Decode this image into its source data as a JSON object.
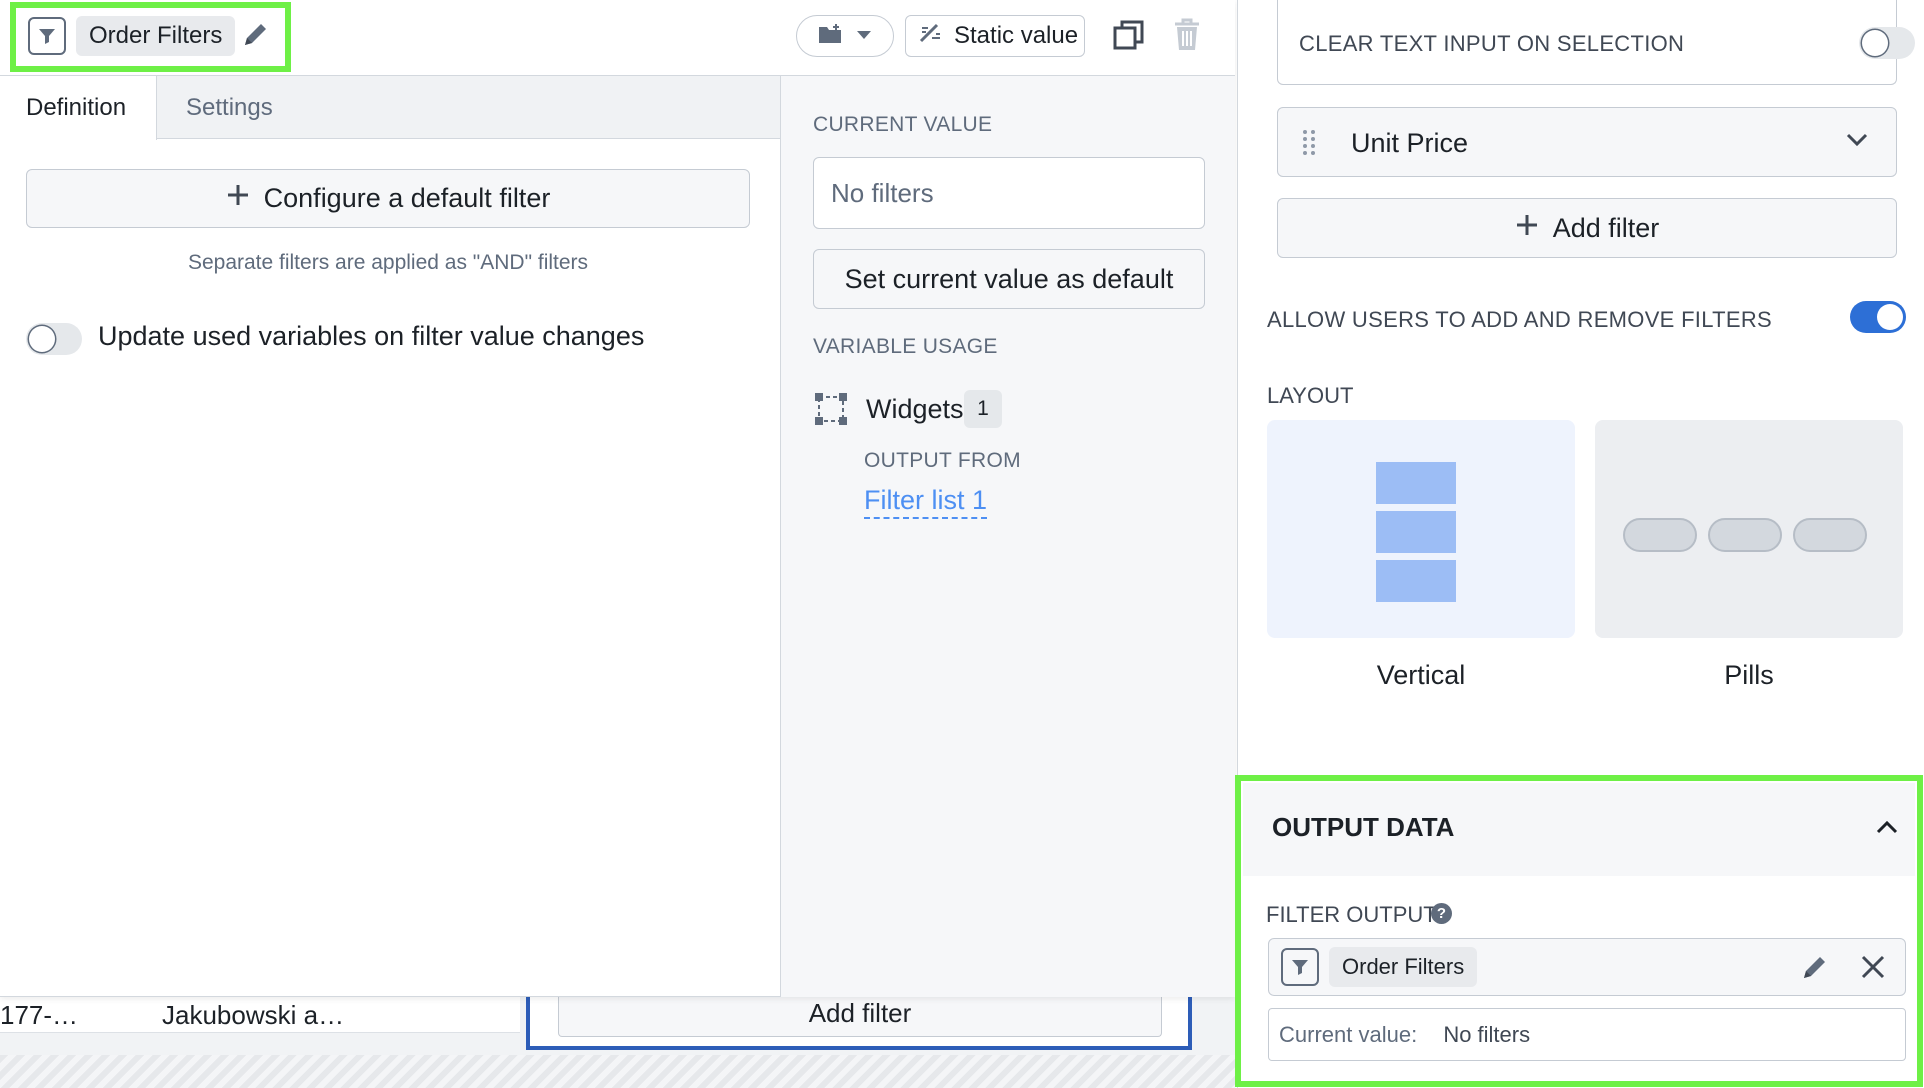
{
  "header": {
    "title": "Order Filters",
    "static_value_label": "Static value"
  },
  "tabs": [
    {
      "label": "Definition",
      "active": true
    },
    {
      "label": "Settings",
      "active": false
    }
  ],
  "definition": {
    "configure_button": "Configure a default filter",
    "and_note": "Separate filters are applied as \"AND\" filters",
    "update_toggle_label": "Update used variables on filter value changes",
    "update_toggle_on": false
  },
  "current_value": {
    "caption": "CURRENT VALUE",
    "value": "No filters",
    "set_default_button": "Set current value as default"
  },
  "variable_usage": {
    "caption": "VARIABLE USAGE",
    "widgets_label": "Widgets",
    "widgets_count": "1",
    "output_from_caption": "OUTPUT FROM",
    "output_from_link": "Filter list 1"
  },
  "config_panel": {
    "clear_text_label": "CLEAR TEXT INPUT ON SELECTION",
    "clear_text_on": false,
    "filter_item": "Unit Price",
    "add_filter_button": "Add filter",
    "allow_users_label": "ALLOW USERS TO ADD AND REMOVE FILTERS",
    "allow_users_on": true,
    "layout_caption": "LAYOUT",
    "layout_options": [
      {
        "label": "Vertical",
        "selected": true
      },
      {
        "label": "Pills",
        "selected": false
      }
    ]
  },
  "output_data": {
    "title": "OUTPUT DATA",
    "filter_output_caption": "FILTER OUTPUT",
    "help_glyph": "?",
    "variable_name": "Order Filters",
    "current_value_key": "Current value:",
    "current_value": "No filters"
  },
  "background": {
    "row_cells": [
      "177-…",
      "Jakubowski a…"
    ],
    "add_filter_button": "Add filter"
  },
  "colors": {
    "highlight": "#6ef046",
    "accent": "#2d6fd6",
    "link": "#4d8ff3"
  }
}
